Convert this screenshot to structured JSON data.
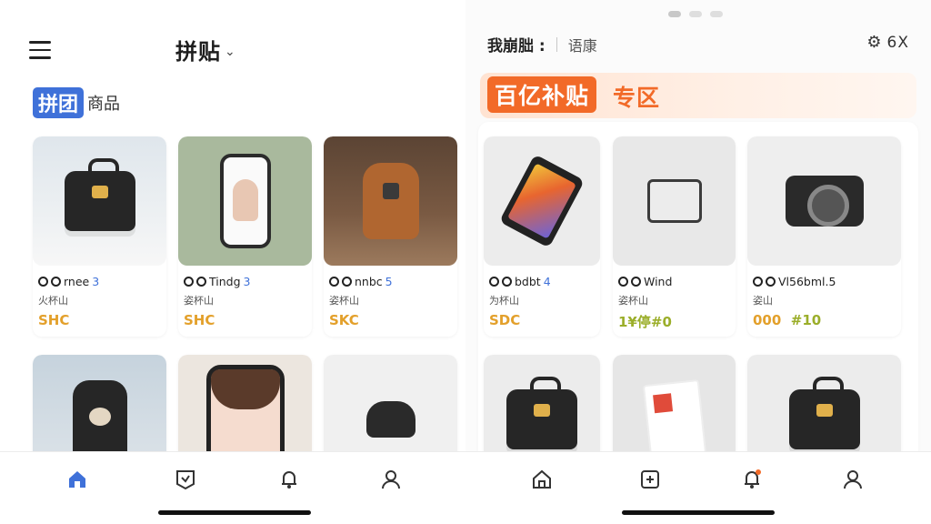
{
  "left": {
    "title": "拼贴",
    "title_chevron": "⌄",
    "section_badge": "拼团",
    "section_label": "商品",
    "cards": [
      {
        "name": "rnee",
        "num": "3",
        "sub": "火杯山",
        "price": "SHC",
        "price_extra": ""
      },
      {
        "name": "Tindg",
        "num": "3",
        "sub": "姿杯山",
        "price": "SHC",
        "price_extra": ""
      },
      {
        "name": "nnbc",
        "num": "5",
        "sub": "姿杯山",
        "price": "SKC",
        "price_extra": ""
      }
    ]
  },
  "right": {
    "brand": "我崩朏 :",
    "sub": "语康",
    "action_text": "6X",
    "banner_badge": "百亿补贴",
    "banner_rest": "专区",
    "cards": [
      {
        "name": "bdbt",
        "num": "4",
        "sub": "为杯山",
        "price": "SDC",
        "price_extra": ""
      },
      {
        "name": "Wind",
        "num": "",
        "sub": "姿杯山",
        "price": "1¥停#0",
        "price_extra": ""
      },
      {
        "name": "Vl56bml.5",
        "num": "",
        "sub": "姿山",
        "price": "000",
        "price_extra": "#10"
      }
    ]
  },
  "icons": {
    "menu": "hamburger-menu-icon",
    "settings": "gear-icon",
    "home": "home-icon",
    "category": "category-icon",
    "bell": "bell-icon",
    "profile": "user-icon"
  },
  "colors": {
    "accent_blue": "#3f71d9",
    "accent_orange": "#f26a28",
    "price_gold": "#e3a02b",
    "price_green": "#9bae2a"
  }
}
